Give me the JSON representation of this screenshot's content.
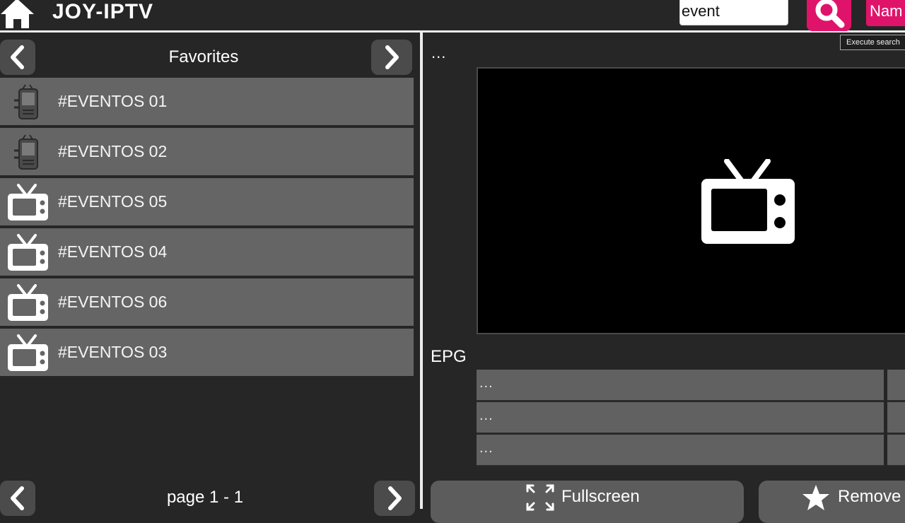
{
  "header": {
    "title": "JOY-IPTV",
    "home_icon": "home-icon",
    "search": {
      "value": "event",
      "icon": "search-icon"
    },
    "name_button_label": "Nam",
    "tooltip": "Execute search"
  },
  "favorites": {
    "title": "Favorites",
    "prev_icon": "chevron-left-icon",
    "next_icon": "chevron-right-icon",
    "channels": [
      {
        "label": "#EVENTOS 01",
        "icon": "channel-logo-icon"
      },
      {
        "label": "#EVENTOS 02",
        "icon": "channel-logo-icon"
      },
      {
        "label": "#EVENTOS 05",
        "icon": "tv-icon"
      },
      {
        "label": "#EVENTOS 04",
        "icon": "tv-icon"
      },
      {
        "label": "#EVENTOS 06",
        "icon": "tv-icon"
      },
      {
        "label": "#EVENTOS 03",
        "icon": "tv-icon"
      }
    ],
    "page_label": "page 1 - 1"
  },
  "player": {
    "title": "...",
    "placeholder_icon": "tv-icon"
  },
  "epg": {
    "label": "EPG",
    "rows": [
      "...",
      "...",
      "..."
    ]
  },
  "actions": {
    "fullscreen_label": "Fullscreen",
    "fullscreen_icon": "expand-icon",
    "remove_label": "Remove",
    "remove_icon": "star-icon"
  },
  "colors": {
    "background": "#262626",
    "accent": "#e0136b",
    "list_item": "#656565",
    "button": "#5c5c5c"
  }
}
